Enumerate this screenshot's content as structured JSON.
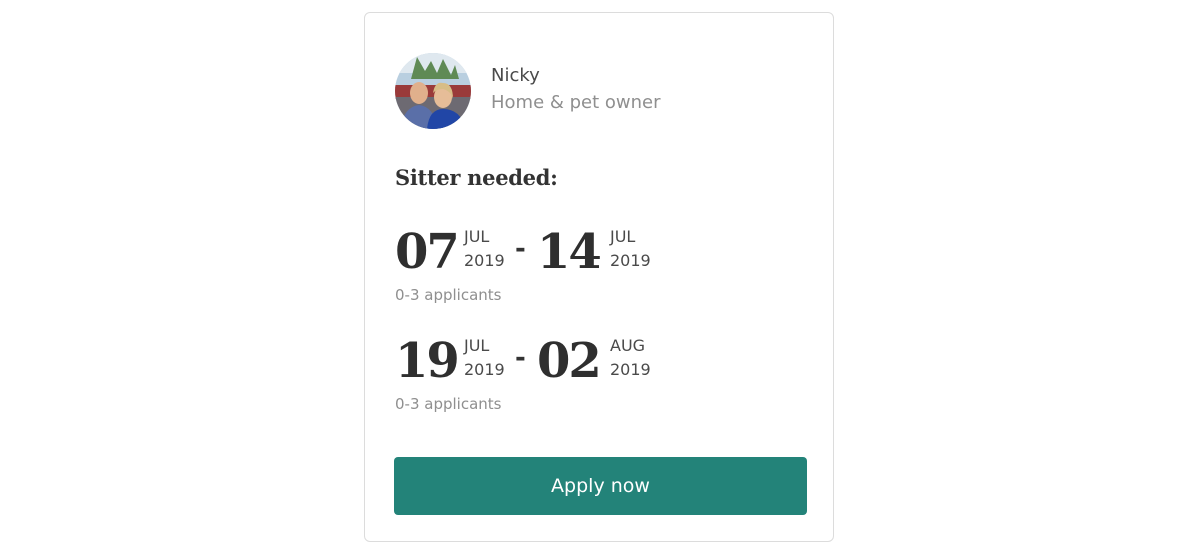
{
  "owner": {
    "name": "Nicky",
    "role": "Home & pet owner"
  },
  "sitter_heading": "Sitter needed:",
  "date_ranges": [
    {
      "start": {
        "day": "07",
        "month": "JUL",
        "year": "2019"
      },
      "separator": "-",
      "end": {
        "day": "14",
        "month": "JUL",
        "year": "2019"
      },
      "applicants": "0-3 applicants"
    },
    {
      "start": {
        "day": "19",
        "month": "JUL",
        "year": "2019"
      },
      "separator": "-",
      "end": {
        "day": "02",
        "month": "AUG",
        "year": "2019"
      },
      "applicants": "0-3 applicants"
    }
  ],
  "apply_button_label": "Apply now",
  "colors": {
    "accent": "#238379",
    "text_dark": "#333333",
    "text_muted": "#8f8f8f",
    "border": "#dcdcdc"
  }
}
